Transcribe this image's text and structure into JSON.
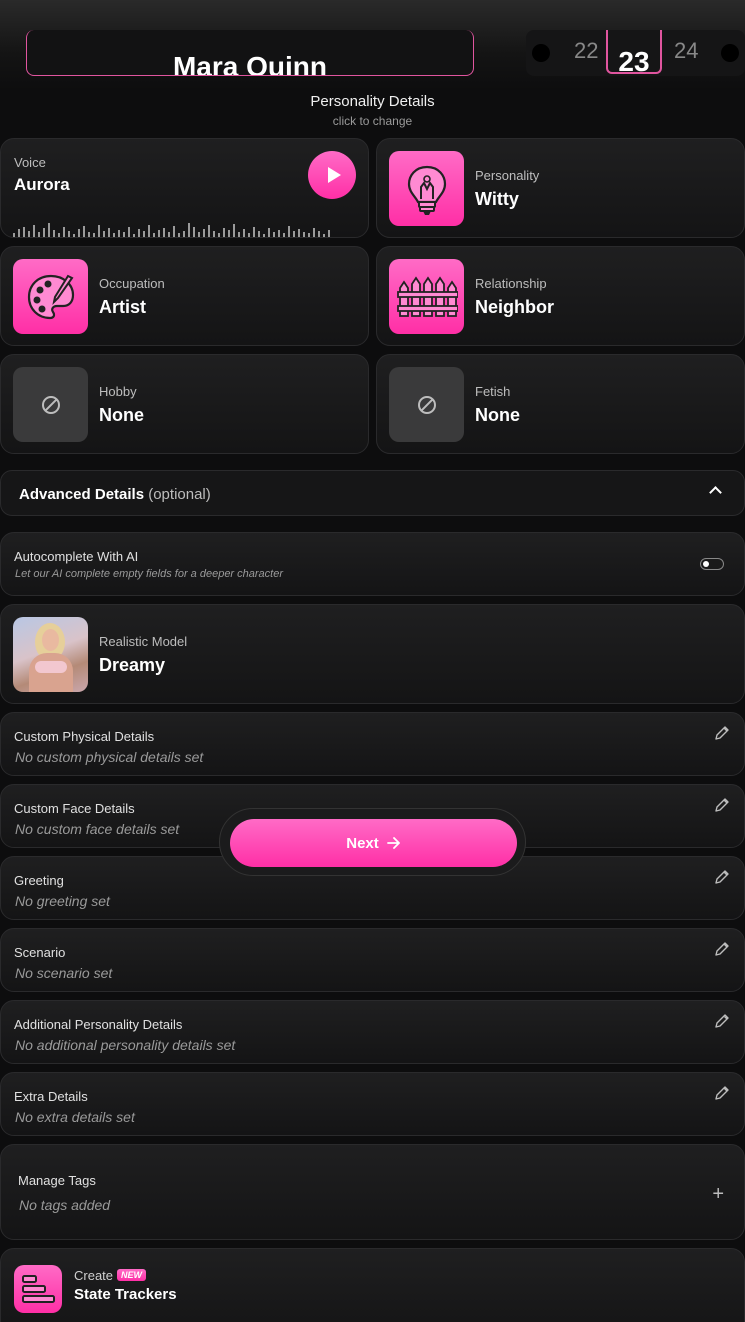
{
  "header": {
    "name_value": "Mara Quinn",
    "date": {
      "prev": "22",
      "selected": "23",
      "next": "24"
    }
  },
  "personality_section": {
    "title": "Personality Details",
    "subtitle": "click to change"
  },
  "cards": {
    "voice": {
      "label": "Voice",
      "value": "Aurora"
    },
    "personality": {
      "label": "Personality",
      "value": "Witty"
    },
    "occupation": {
      "label": "Occupation",
      "value": "Artist"
    },
    "relationship": {
      "label": "Relationship",
      "value": "Neighbor"
    },
    "hobby": {
      "label": "Hobby",
      "value": "None"
    },
    "fetish": {
      "label": "Fetish",
      "value": "None"
    }
  },
  "advanced": {
    "title": "Advanced Details",
    "optional": "(optional)",
    "expanded": true
  },
  "autocomplete": {
    "label": "Autocomplete With AI",
    "hint": "Let our AI complete empty fields for a deeper character",
    "enabled": false
  },
  "model": {
    "label": "Realistic Model",
    "value": "Dreamy"
  },
  "details": [
    {
      "label": "Custom Physical Details",
      "value": "No custom physical details set"
    },
    {
      "label": "Custom Face Details",
      "value": "No custom face details set"
    },
    {
      "label": "Greeting",
      "value": "No greeting set"
    },
    {
      "label": "Scenario",
      "value": "No scenario set"
    },
    {
      "label": "Additional Personality Details",
      "value": "No additional personality details set"
    },
    {
      "label": "Extra Details",
      "value": "No extra details set"
    }
  ],
  "tags": {
    "label": "Manage Tags",
    "value": "No tags added",
    "add_icon": "plus-icon"
  },
  "state_trackers": {
    "prefix": "Create",
    "badge": "NEW",
    "title": "State Trackers"
  },
  "next_button": {
    "label": "Next",
    "icon": "arrow-right-icon"
  },
  "colors": {
    "accent": "#ff2fa6",
    "accent_light": "#ff6bc6",
    "background": "#0d0d0e"
  }
}
